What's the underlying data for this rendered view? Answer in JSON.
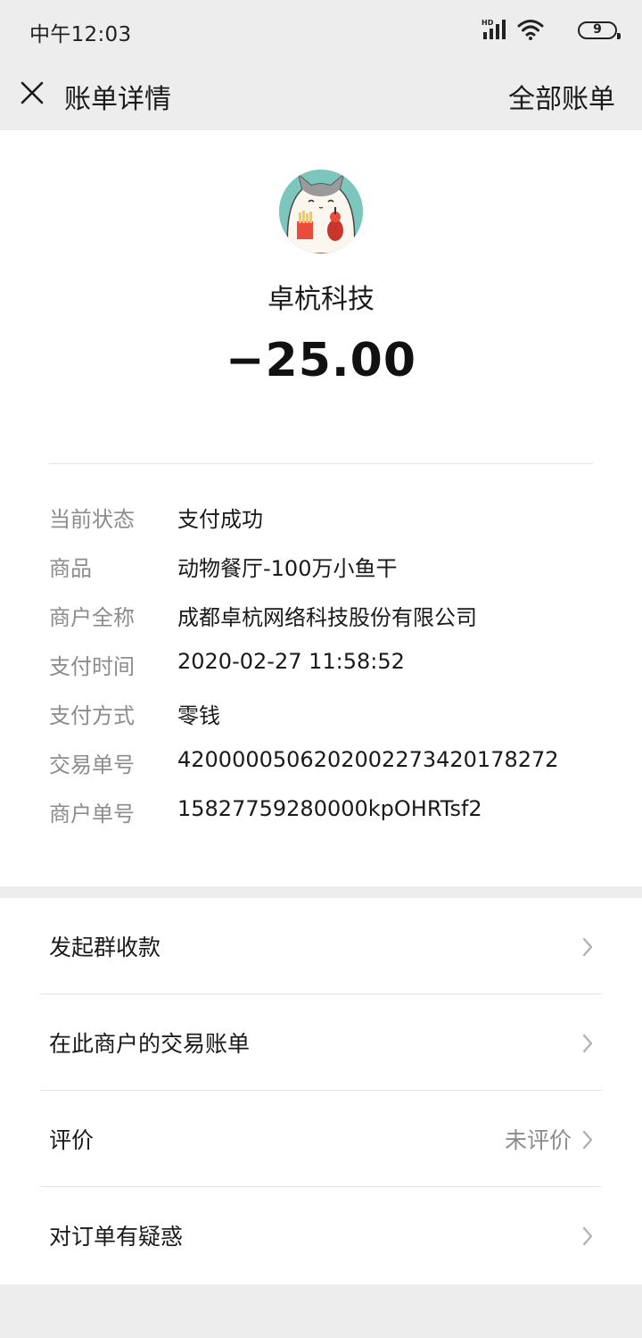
{
  "status_bar": {
    "time": "中午12:03",
    "signal_badge": "HD",
    "battery_level": "9",
    "icons": [
      "signal-icon",
      "wifi-icon",
      "battery-icon"
    ]
  },
  "nav": {
    "close_icon": "close-icon",
    "title": "账单详情",
    "right_link": "全部账单"
  },
  "merchant": {
    "name": "卓杭科技",
    "amount": "−25.00",
    "avatar_icon": "cat-avatar-icon"
  },
  "details": [
    {
      "label": "当前状态",
      "value": "支付成功"
    },
    {
      "label": "商品",
      "value": "动物餐厅-100万小鱼干"
    },
    {
      "label": "商户全称",
      "value": "成都卓杭网络科技股份有限公司"
    },
    {
      "label": "支付时间",
      "value": "2020-02-27 11:58:52"
    },
    {
      "label": "支付方式",
      "value": "零钱"
    },
    {
      "label": "交易单号",
      "value": "4200000506202002273420178272"
    },
    {
      "label": "商户单号",
      "value": "15827759280000kpOHRTsf2"
    }
  ],
  "menu": [
    {
      "label": "发起群收款",
      "extra": ""
    },
    {
      "label": "在此商户的交易账单",
      "extra": ""
    },
    {
      "label": "评价",
      "extra": "未评价"
    },
    {
      "label": "对订单有疑惑",
      "extra": ""
    }
  ],
  "colors": {
    "page_background": "#ededed",
    "card_background": "#ffffff",
    "secondary_text": "#8c8c8c",
    "avatar_background": "#7cc6bd"
  }
}
